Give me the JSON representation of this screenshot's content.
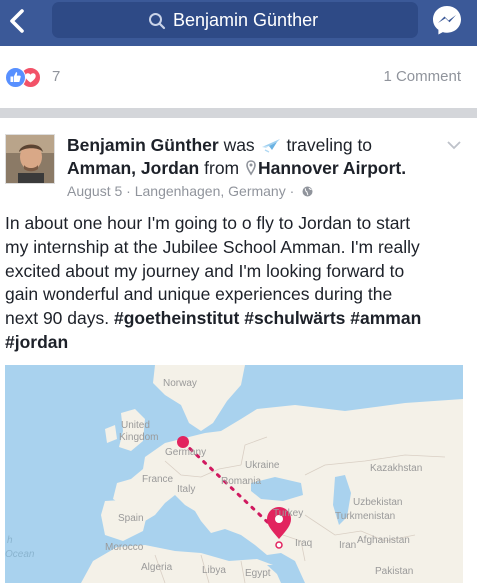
{
  "topbar": {
    "search_text": "Benjamin Günther",
    "colors": {
      "bar": "#3b5998",
      "search_box": "#2e4a86"
    }
  },
  "reactions": {
    "reaction_count": "7",
    "comment_count": "1 Comment",
    "icons": [
      "like-icon",
      "love-icon"
    ]
  },
  "post": {
    "author": "Benjamin Günther",
    "was": "was",
    "traveling_to": "traveling to",
    "destination": "Amman, Jordan",
    "from": "from",
    "origin": "Hannover Airport.",
    "date": "August 5",
    "location": "Langenhagen, Germany",
    "body_lines": [
      "In about one hour I'm going to o fly to Jordan to start",
      "my internship at the Jubilee School Amman. I'm really",
      "excited about my journey and I'm looking forward to",
      "gain wonderful and unique experiences during the"
    ],
    "body_last_prefix": "next 90 days. ",
    "hashtags_line1": "#goetheinstitut #schulwärts #amman",
    "hashtags_line2": "#jordan"
  },
  "map": {
    "labels": {
      "norway": "Norway",
      "united": "United",
      "kingdom": "Kingdom",
      "germany": "Germany",
      "france": "France",
      "italy": "Italy",
      "spain": "Spain",
      "ukraine": "Ukraine",
      "romania": "Romania",
      "turkey": "Turkey",
      "kazakhstan": "Kazakhstan",
      "uzbekistan": "Uzbekistan",
      "turkmenistan": "Turkmenistan",
      "afghanistan": "Afghanistan",
      "iran": "Iran",
      "iraq": "Iraq",
      "morocco": "Morocco",
      "algeria": "Algeria",
      "libya": "Libya",
      "egypt": "Egypt",
      "pakistan": "Pakistan",
      "ocean_h": "h",
      "ocean": "Ocean"
    },
    "colors": {
      "sea": "#a9d2ee",
      "land": "#f4f1e8",
      "route": "#d0195f",
      "pin": "#e2245f"
    }
  }
}
